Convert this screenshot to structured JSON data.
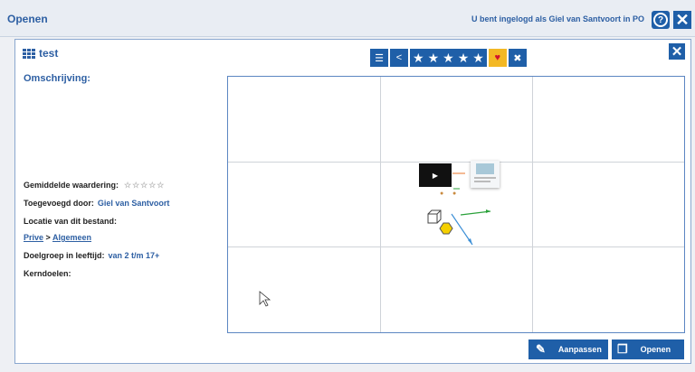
{
  "window": {
    "title": "Openen",
    "login_text": "U bent ingelogd als Giel van Santvoort in PO",
    "help_icon": "?",
    "close_icon": "✕"
  },
  "panel": {
    "title": "test",
    "close_icon": "✕",
    "toolbar": {
      "doc_icon": "☰",
      "share_icon": "<",
      "stars": [
        "★",
        "★",
        "★",
        "★",
        "★"
      ],
      "favorite_icon": "♥",
      "trash_icon": "✖"
    },
    "description_label": "Omschrijving:",
    "rating_label": "Gemiddelde waardering:",
    "rating_stars": "☆☆☆☆☆",
    "added_by_label": "Toegevoegd door:",
    "added_by_value": "Giel van Santvoort",
    "location_label": "Locatie van dit bestand:",
    "location_path": [
      "Prive",
      "Algemeen"
    ],
    "location_separator": ">",
    "age_label": "Doelgroep in leeftijd:",
    "age_value": "van 2 t/m 17+",
    "core_goals_label": "Kerndoelen:",
    "video_play": "▶",
    "buttons": {
      "edit": "Aanpassen",
      "edit_icon": "✎",
      "open": "Openen",
      "open_icon": "❐"
    }
  }
}
